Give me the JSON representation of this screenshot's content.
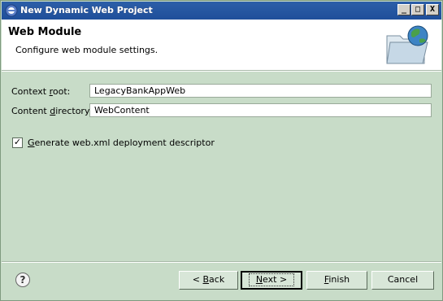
{
  "window": {
    "title": "New Dynamic Web Project",
    "buttons": {
      "minimize": "_",
      "maximize": "□",
      "close": "X"
    }
  },
  "header": {
    "title": "Web Module",
    "description": "Configure web module settings.",
    "icon": "folder-globe-icon"
  },
  "fields": {
    "context_root": {
      "label_pre": "Context ",
      "label_u": "r",
      "label_post": "oot:",
      "value": "LegacyBankAppWeb"
    },
    "content_directory": {
      "label_pre": "Content ",
      "label_u": "d",
      "label_post": "irectory:",
      "value": "WebContent"
    }
  },
  "checkbox": {
    "checked": true,
    "label_u": "G",
    "label_post": "enerate web.xml deployment descriptor"
  },
  "footer": {
    "help_icon": "?",
    "back": {
      "pre": "< ",
      "u": "B",
      "post": "ack"
    },
    "next": {
      "u": "N",
      "post": "ext >"
    },
    "finish": {
      "u": "F",
      "post": "inish"
    },
    "cancel": "Cancel"
  },
  "colors": {
    "dialog_bg": "#c8dcc8",
    "header_bg": "#ffffff",
    "titlebar": "#2c5ea8"
  }
}
